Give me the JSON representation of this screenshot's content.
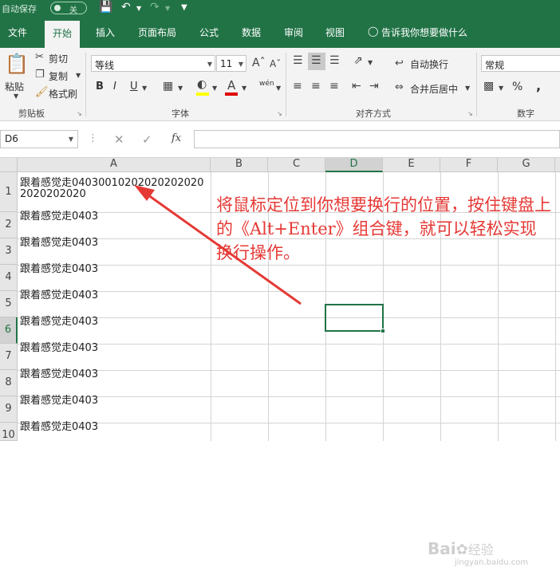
{
  "titlebar": {
    "autosave_label": "自动保存",
    "autosave_state": "关"
  },
  "tabs": [
    {
      "label": "文件"
    },
    {
      "label": "开始"
    },
    {
      "label": "插入"
    },
    {
      "label": "页面布局"
    },
    {
      "label": "公式"
    },
    {
      "label": "数据"
    },
    {
      "label": "审阅"
    },
    {
      "label": "视图"
    }
  ],
  "tell_me": "告诉我你想要做什么",
  "clipboard": {
    "paste": "粘贴",
    "cut": "剪切",
    "copy": "复制",
    "format_painter": "格式刷",
    "group": "剪贴板"
  },
  "font": {
    "name": "等线",
    "size": "11",
    "bold": "B",
    "italic": "I",
    "underline": "U",
    "group": "字体",
    "wen": "wén"
  },
  "alignment": {
    "wrap_text": "自动换行",
    "merge_center": "合并后居中",
    "group": "对齐方式"
  },
  "number": {
    "format": "常规",
    "percent": "%",
    "comma": ",",
    "group": "数字"
  },
  "formula_bar": {
    "name_box": "D6",
    "fx": "fx",
    "value": ""
  },
  "columns": [
    "A",
    "B",
    "C",
    "D",
    "E",
    "F",
    "G"
  ],
  "selected_column": "D",
  "selected_row": "6",
  "rows": [
    {
      "num": "1",
      "a_line1": "跟着感觉走04030010202020202020",
      "a_line2": "2020202020"
    },
    {
      "num": "2",
      "a": "跟着感觉走0403"
    },
    {
      "num": "3",
      "a": "跟着感觉走0403"
    },
    {
      "num": "4",
      "a": "跟着感觉走0403"
    },
    {
      "num": "5",
      "a": "跟着感觉走0403"
    },
    {
      "num": "6",
      "a": "跟着感觉走0403"
    },
    {
      "num": "7",
      "a": "跟着感觉走0403"
    },
    {
      "num": "8",
      "a": "跟着感觉走0403"
    },
    {
      "num": "9",
      "a": "跟着感觉走0403"
    },
    {
      "num": "10",
      "a": "跟着感觉走0403"
    }
  ],
  "annotation": {
    "text": "将鼠标定位到你想要换行的位置，按住键盘上的《Alt+Enter》组合键，就可以轻松实现换行操作。",
    "color": "#e53935"
  },
  "watermark": {
    "logo": "Bai",
    "logo_cn": "经验",
    "url": "jingyan.baidu.com"
  },
  "colors": {
    "excel_green": "#217346",
    "ribbon_bg": "#f3f3f3",
    "header_bg": "#e6e6e6"
  }
}
